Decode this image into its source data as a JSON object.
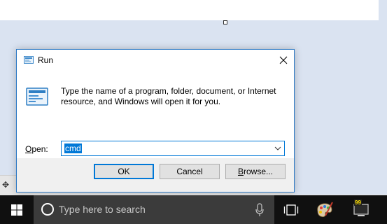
{
  "dialog": {
    "title": "Run",
    "description": "Type the name of a program, folder, document, or Internet resource, and Windows will open it for you.",
    "open_label_mnemonic": "O",
    "open_label_rest": "pen:",
    "open_value": "cmd",
    "ok_label": "OK",
    "cancel_label": "Cancel",
    "browse_label_mnemonic": "B",
    "browse_label_rest": "rowse..."
  },
  "taskbar": {
    "search_placeholder": "Type here to search",
    "terminal_badge": "99"
  },
  "icons": {
    "title": "run-icon",
    "big": "run-icon",
    "close": "close-icon",
    "dropdown": "chevron-down-icon",
    "start": "windows-logo-icon",
    "cortana": "cortana-icon",
    "mic": "microphone-icon",
    "taskview": "task-view-icon",
    "paint": "paint-palette-icon",
    "terminal": "terminal-icon",
    "move": "move-icon"
  },
  "colors": {
    "accent": "#0078d7",
    "taskbar": "#101010",
    "search_box": "#3b3b3b",
    "desktop": "#dae3f1"
  }
}
